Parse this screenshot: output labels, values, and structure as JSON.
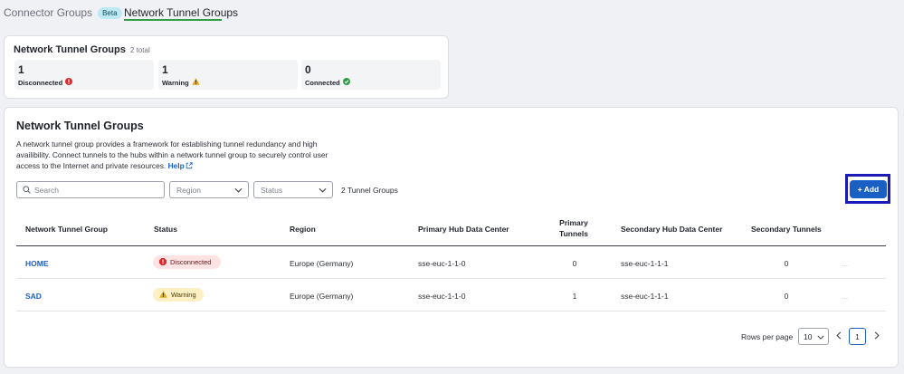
{
  "tabs": {
    "connector_groups": "Connector Groups",
    "beta": "Beta",
    "network_tunnel_groups": "Network Tunnel Groups"
  },
  "summary": {
    "title": "Network Tunnel Groups",
    "total": "2 total",
    "stats": [
      {
        "value": "1",
        "label": "Disconnected",
        "icon": "error-icon",
        "color": "#d92d2d"
      },
      {
        "value": "1",
        "label": "Warning",
        "icon": "warning-icon",
        "color": "#e4a512"
      },
      {
        "value": "0",
        "label": "Connected",
        "icon": "check-circle-icon",
        "color": "#2f9d46"
      }
    ]
  },
  "main": {
    "title": "Network Tunnel Groups",
    "description": "A network tunnel group provides a framework for establishing tunnel redundancy and high availibility. Connect tunnels to the hubs within a network tunnel group to securely control user access to the Internet and private resources.",
    "help_label": "Help",
    "search_placeholder": "Search",
    "region_placeholder": "Region",
    "status_placeholder": "Status",
    "group_count": "2 Tunnel Groups",
    "add_label": "+ Add"
  },
  "table": {
    "headers": {
      "name": "Network Tunnel Group",
      "status": "Status",
      "region": "Region",
      "primary_hub": "Primary Hub Data Center",
      "primary_tunnels_1": "Primary",
      "primary_tunnels_2": "Tunnels",
      "secondary_hub": "Secondary Hub Data Center",
      "secondary_tunnels": "Secondary Tunnels"
    },
    "rows": [
      {
        "name": "HOME",
        "status": "Disconnected",
        "region": "Europe (Germany)",
        "primary_hub": "sse-euc-1-1-0",
        "primary_tunnels": "0",
        "secondary_hub": "sse-euc-1-1-1",
        "secondary_tunnels": "0",
        "actions": "..."
      },
      {
        "name": "SAD",
        "status": "Warning",
        "region": "Europe (Germany)",
        "primary_hub": "sse-euc-1-1-0",
        "primary_tunnels": "1",
        "secondary_hub": "sse-euc-1-1-1",
        "secondary_tunnels": "0",
        "actions": "..."
      }
    ]
  },
  "pagination": {
    "rows_per_page_label": "Rows per page",
    "rows_per_page": "10",
    "current_page": "1"
  },
  "colors": {
    "accent": "#1a5fc4",
    "tab_underline": "#2f9d46",
    "highlight": "#1a1ab8"
  }
}
